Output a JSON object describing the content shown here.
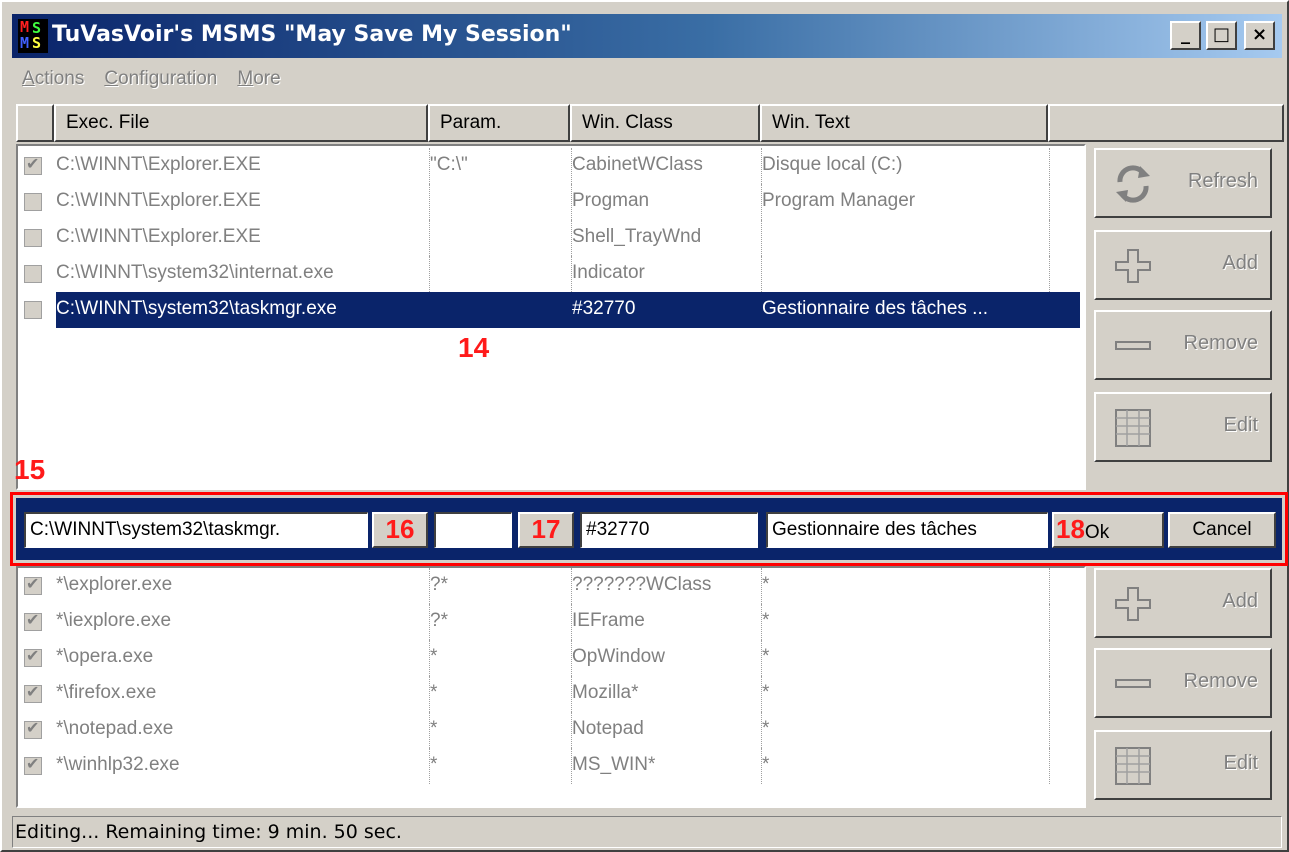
{
  "window": {
    "title": "TuVasVoir's MSMS \"May Save My Session\"",
    "logo_letters": [
      "M",
      "S",
      "M",
      "S"
    ],
    "minimize_glyph": "_",
    "maximize_glyph": "□",
    "close_glyph": "×"
  },
  "menu": {
    "items": [
      {
        "label": "Actions",
        "underline": "A",
        "rest": "ctions"
      },
      {
        "label": "Configuration",
        "underline": "C",
        "rest": "onfiguration"
      },
      {
        "label": "More",
        "underline": "M",
        "rest": "ore"
      }
    ]
  },
  "columns": [
    "Exec. File",
    "Param.",
    "Win. Class",
    "Win. Text"
  ],
  "sessions": [
    {
      "checked": true,
      "exec": "C:\\WINNT\\Explorer.EXE",
      "param": "\"C:\\\"",
      "class": "CabinetWClass",
      "text": "Disque local (C:)"
    },
    {
      "checked": false,
      "exec": "C:\\WINNT\\Explorer.EXE",
      "param": "",
      "class": "Progman",
      "text": "Program Manager"
    },
    {
      "checked": false,
      "exec": "C:\\WINNT\\Explorer.EXE",
      "param": "",
      "class": "Shell_TrayWnd",
      "text": ""
    },
    {
      "checked": false,
      "exec": "C:\\WINNT\\system32\\internat.exe",
      "param": "",
      "class": "Indicator",
      "text": ""
    },
    {
      "checked": false,
      "exec": "C:\\WINNT\\system32\\taskmgr.exe",
      "param": "",
      "class": "#32770",
      "text": "Gestionnaire des tâches ...",
      "selected": true
    }
  ],
  "rules": [
    {
      "checked": true,
      "exec": "*\\explorer.exe",
      "param": "?*",
      "class": "???????WClass",
      "text": "*"
    },
    {
      "checked": true,
      "exec": "*\\iexplore.exe",
      "param": "?*",
      "class": "IEFrame",
      "text": "*"
    },
    {
      "checked": true,
      "exec": "*\\opera.exe",
      "param": "*",
      "class": "OpWindow",
      "text": "*"
    },
    {
      "checked": true,
      "exec": "*\\firefox.exe",
      "param": "*",
      "class": "Mozilla*",
      "text": "*"
    },
    {
      "checked": true,
      "exec": "*\\notepad.exe",
      "param": "*",
      "class": "Notepad",
      "text": "*"
    },
    {
      "checked": true,
      "exec": "*\\winhlp32.exe",
      "param": "*",
      "class": "MS_WIN*",
      "text": "*"
    }
  ],
  "top_buttons": {
    "refresh": "Refresh",
    "add": "Add",
    "remove": "Remove",
    "edit": "Edit"
  },
  "bottom_buttons": {
    "add": "Add",
    "remove": "Remove",
    "edit": "Edit"
  },
  "editor": {
    "exec_value": "C:\\WINNT\\system32\\taskmgr.",
    "param_value": "",
    "class_value": "#32770",
    "text_value": "Gestionnaire des tâches",
    "ok_label": "Ok",
    "cancel_label": "Cancel"
  },
  "annotations": {
    "a14": "14",
    "a15": "15",
    "a16": "16",
    "a17": "17",
    "a18": "18"
  },
  "status": {
    "text": "Editing...   Remaining time: 9 min. 50 sec."
  },
  "colors": {
    "selection": "#0a246a",
    "annotation": "#ff1a1a",
    "title_start": "#0a246a",
    "title_end": "#a6caf0"
  }
}
